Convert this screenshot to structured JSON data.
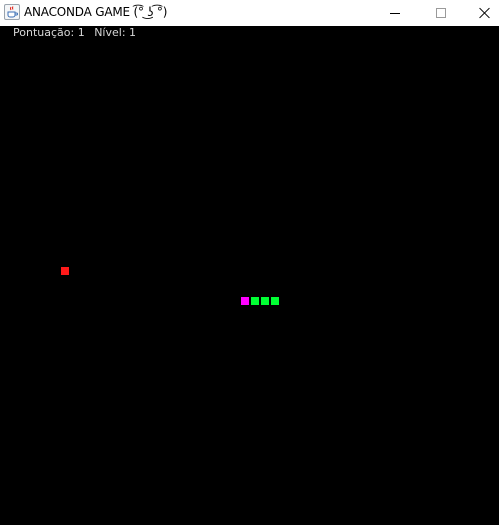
{
  "window": {
    "title": "ANACONDA GAME (͡° ͜ʖ ͡°)",
    "app_icon": "java-cup-icon",
    "controls": [
      "minimize-icon",
      "maximize-icon",
      "close-icon"
    ]
  },
  "hud": {
    "score_label": "Pontuação: 1",
    "level_label": "Nível: 1"
  },
  "game": {
    "background_color": "#000000",
    "snake": {
      "length": 4,
      "direction": "left",
      "head_color": "#ff00ff",
      "body_color": "#00ff33"
    },
    "food": {
      "color": "#ff1a1a"
    }
  }
}
